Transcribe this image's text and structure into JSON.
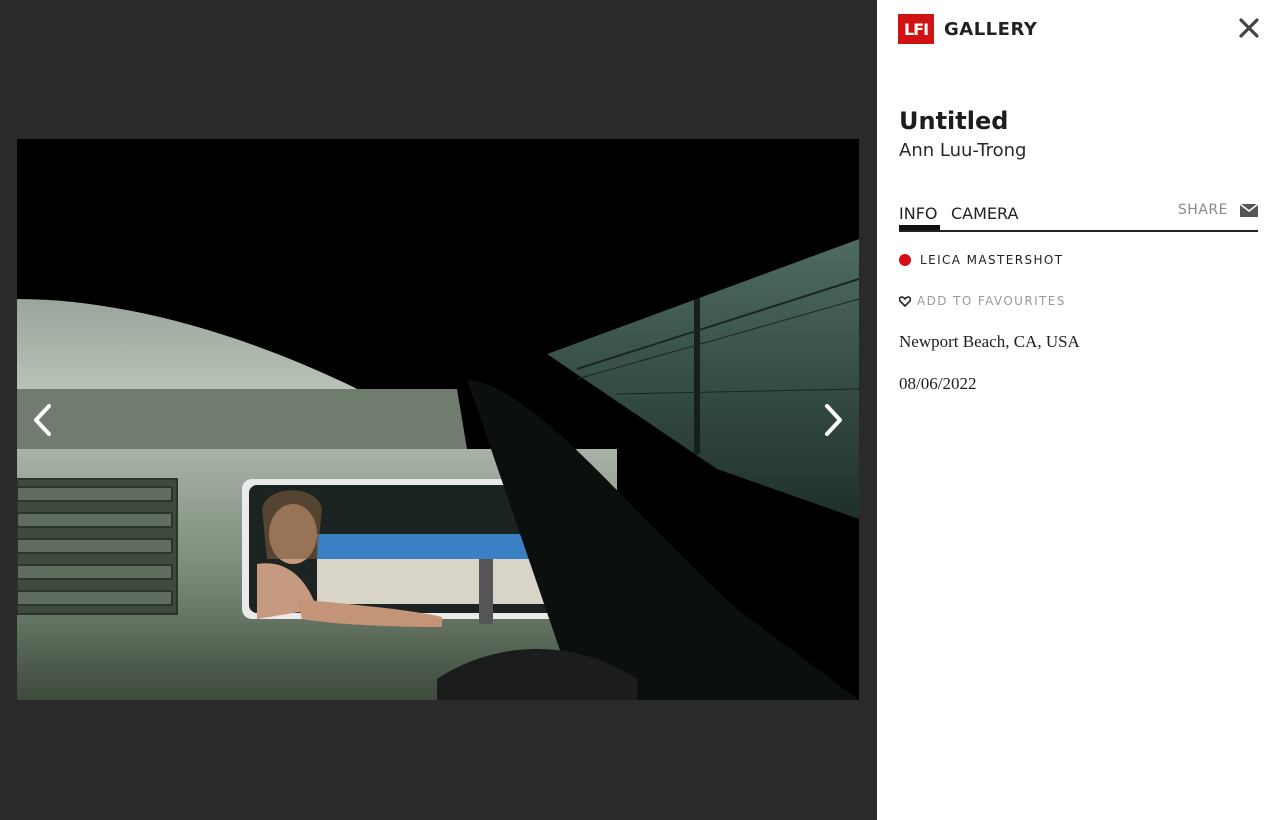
{
  "brand": {
    "logo_text": "LFI",
    "name": "GALLERY",
    "logo_color": "#d11212"
  },
  "photo": {
    "title": "Untitled",
    "artist": "Ann Luu-Trong",
    "subject": "woman-in-van-window-photo"
  },
  "tabs": [
    {
      "label": "INFO",
      "active": true
    },
    {
      "label": "CAMERA",
      "active": false
    }
  ],
  "share": {
    "label": "SHARE",
    "icon": "envelope-icon"
  },
  "badge": {
    "label": "LEICA MASTERSHOT",
    "dot_color": "#d40e14"
  },
  "favourites": {
    "label": "ADD TO FAVOURITES",
    "icon": "heart-icon"
  },
  "info": {
    "location": "Newport Beach, CA, USA",
    "date": "08/06/2022"
  },
  "navigation": {
    "prev_icon": "chevron-left-icon",
    "next_icon": "chevron-right-icon",
    "close_icon": "close-icon"
  }
}
